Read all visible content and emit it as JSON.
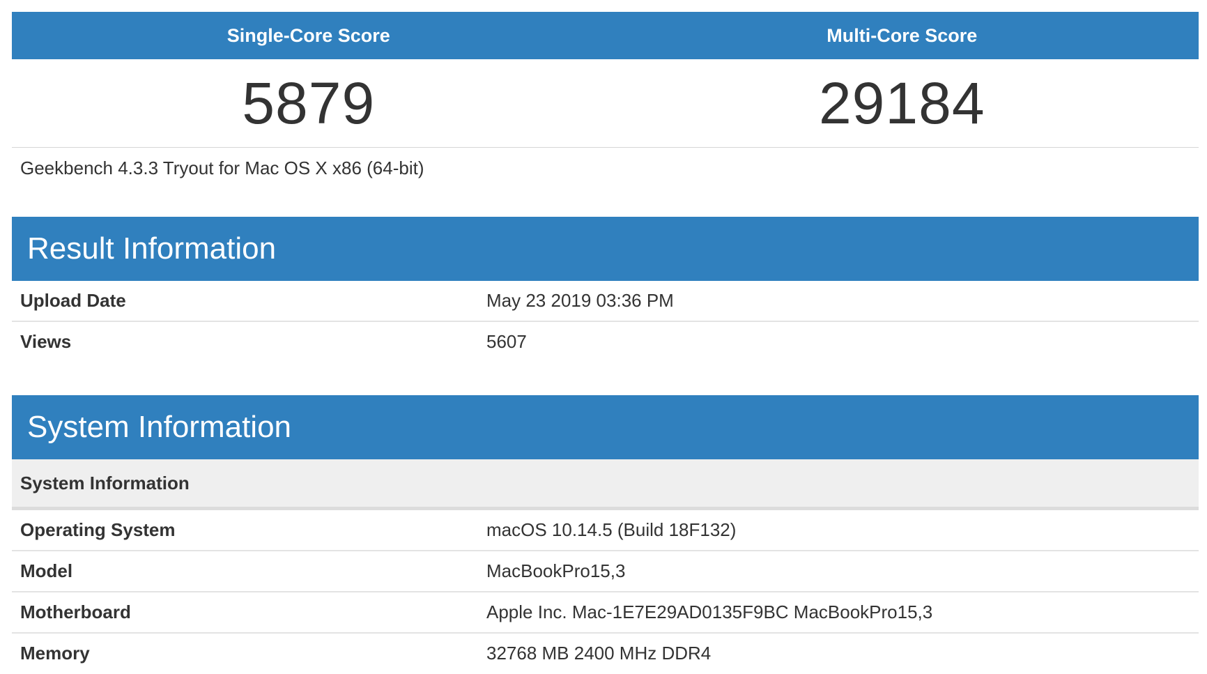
{
  "scores": {
    "single_core_label": "Single-Core Score",
    "multi_core_label": "Multi-Core Score",
    "single_core_value": "5879",
    "multi_core_value": "29184"
  },
  "version": "Geekbench 4.3.3 Tryout for Mac OS X x86 (64-bit)",
  "result_information": {
    "title": "Result Information",
    "rows": [
      {
        "label": "Upload Date",
        "value": "May 23 2019 03:36 PM"
      },
      {
        "label": "Views",
        "value": "5607"
      }
    ]
  },
  "system_information": {
    "title": "System Information",
    "subheader": "System Information",
    "rows": [
      {
        "label": "Operating System",
        "value": "macOS 10.14.5 (Build 18F132)"
      },
      {
        "label": "Model",
        "value": "MacBookPro15,3"
      },
      {
        "label": "Motherboard",
        "value": "Apple Inc. Mac-1E7E29AD0135F9BC MacBookPro15,3"
      },
      {
        "label": "Memory",
        "value": "32768 MB 2400 MHz DDR4"
      }
    ]
  },
  "colors": {
    "header_blue": "#3080be",
    "text": "#333333",
    "subheader_bg": "#efefef"
  }
}
